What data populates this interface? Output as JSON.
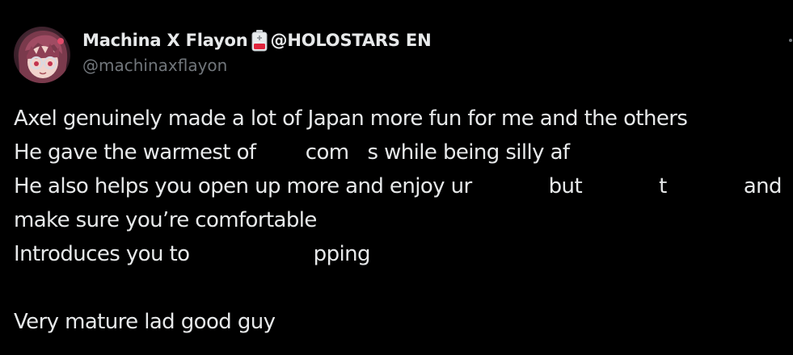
{
  "tweet": {
    "author": {
      "display_name": "Machina X Flayon",
      "battery_icon": "low-battery-emoji",
      "name_suffix": "@HOLOSTARS EN",
      "handle": "@machinaxflayon"
    },
    "lines": [
      "Axel genuinely made a lot of Japan more fun for me and the others",
      "He gave the warmest of        com   s while being silly af",
      "He also helps you open up more and enjoy ur        but        t        and",
      "make sure you’re comfortable",
      "Introduces you to                    pping",
      "",
      "Very mature lad good guy"
    ],
    "line3_segments": [
      "He also helps you open up more and enjoy ur",
      "but",
      "t",
      "and"
    ]
  },
  "colors": {
    "background": "#000000",
    "text_primary": "#e7e9ea",
    "text_secondary": "#71767b"
  }
}
